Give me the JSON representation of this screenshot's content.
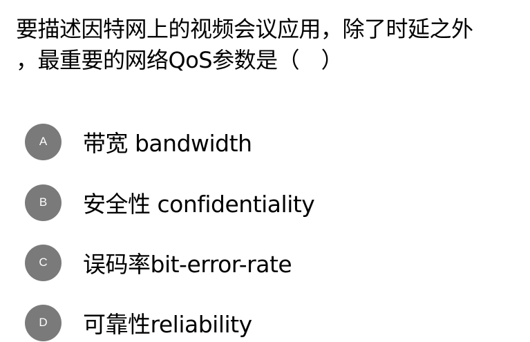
{
  "question": {
    "line1": "要描述因特网上的视频会议应用，除了时延之外",
    "line2": "，最重要的网络QoS参数是（　）"
  },
  "options": [
    {
      "letter": "A",
      "text": "带宽 bandwidth"
    },
    {
      "letter": "B",
      "text": "安全性 confidentiality"
    },
    {
      "letter": "C",
      "text": "误码率bit-error-rate"
    },
    {
      "letter": "D",
      "text": "可靠性reliability"
    }
  ],
  "colors": {
    "badge": "#7a7a7a",
    "badge_text": "#ffffff",
    "text": "#000000",
    "background": "#ffffff"
  }
}
